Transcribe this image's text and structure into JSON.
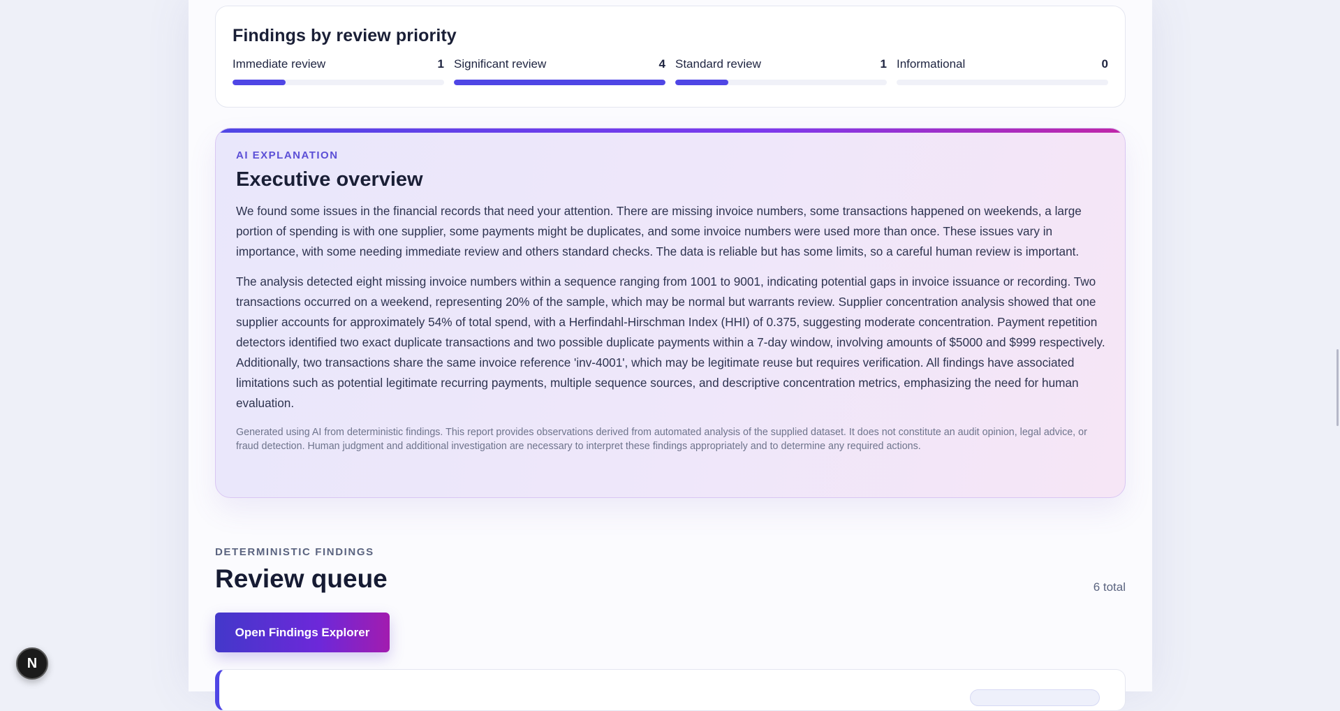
{
  "priority": {
    "title": "Findings by review priority",
    "items": [
      {
        "label": "Immediate review",
        "count": "1",
        "fill": 0.25
      },
      {
        "label": "Significant review",
        "count": "4",
        "fill": 1.0
      },
      {
        "label": "Standard review",
        "count": "1",
        "fill": 0.25
      },
      {
        "label": "Informational",
        "count": "0",
        "fill": 0.0
      }
    ],
    "bar_color": "#4f46e5"
  },
  "ai": {
    "eyebrow": "AI EXPLANATION",
    "title": "Executive overview",
    "paragraph1": "We found some issues in the financial records that need your attention. There are missing invoice numbers, some transactions happened on weekends, a large portion of spending is with one supplier, some payments might be duplicates, and some invoice numbers were used more than once. These issues vary in importance, with some needing immediate review and others standard checks. The data is reliable but has some limits, so a careful human review is important.",
    "paragraph2": "The analysis detected eight missing invoice numbers within a sequence ranging from 1001 to 9001, indicating potential gaps in invoice issuance or recording. Two transactions occurred on a weekend, representing 20% of the sample, which may be normal but warrants review. Supplier concentration analysis showed that one supplier accounts for approximately 54% of total spend, with a Herfindahl-Hirschman Index (HHI) of 0.375, suggesting moderate concentration. Payment repetition detectors identified two exact duplicate transactions and two possible duplicate payments within a 7-day window, involving amounts of $5000 and $999 respectively. Additionally, two transactions share the same invoice reference 'inv-4001', which may be legitimate reuse but requires verification. All findings have associated limitations such as potential legitimate recurring payments, multiple sequence sources, and descriptive concentration metrics, emphasizing the need for human evaluation.",
    "disclaimer": "Generated using AI from deterministic findings. This report provides observations derived from automated analysis of the supplied dataset. It does not constitute an audit opinion, legal advice, or fraud detection. Human judgment and additional investigation are necessary to interpret these findings appropriately and to determine any required actions."
  },
  "review_queue": {
    "eyebrow": "DETERMINISTIC FINDINGS",
    "title": "Review queue",
    "total": "6 total",
    "button_label": "Open Findings Explorer"
  },
  "dev_badge": {
    "letter": "N"
  }
}
